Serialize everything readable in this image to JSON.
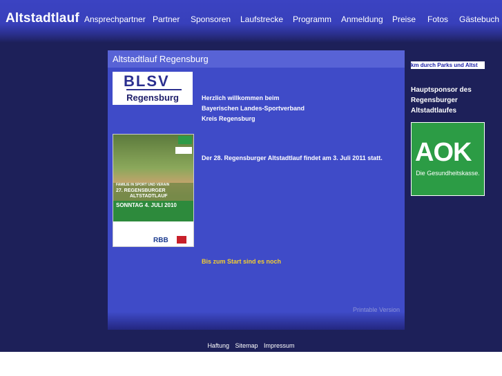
{
  "header": {
    "site_title": "Altstadtlauf",
    "nav": [
      {
        "label": "Ansprechpartner"
      },
      {
        "label": "Partner"
      },
      {
        "label": "Sponsoren"
      },
      {
        "label": "Laufstrecke"
      },
      {
        "label": "Programm"
      },
      {
        "label": "Anmeldung"
      },
      {
        "label": "Preise"
      },
      {
        "label": "Fotos"
      },
      {
        "label": "Gästebuch"
      }
    ]
  },
  "main": {
    "title": "Altstadtlauf Regensburg",
    "blsv_logo": {
      "mark": "BLSV",
      "city": "Regensburg"
    },
    "welcome": [
      "Herzlich willkommen beim",
      "Bayerischen Landes-Sportverband",
      "Kreis Regensburg"
    ],
    "poster": {
      "line1": "FAMILIE IN SPORT UND VERAIN",
      "line2": "27. REGENSBURGER",
      "line3": "ALTSTADTLAUF",
      "date": "SONNTAG  4. JULI 2010",
      "sponsor": "RBB"
    },
    "race_info": "Der 28. Regensburger Altstadtlauf findet am 3. Juli 2011 statt.",
    "countdown": "Bis zum Start sind es noch",
    "printable": "Printable Version"
  },
  "sidebar": {
    "marquee": "km durch Parks und Altst",
    "sponsor_label": [
      "Hauptsponsor des",
      "Regensburger",
      "Altstadtlaufes"
    ],
    "aok_logo": {
      "mark": "AOK",
      "tagline": "Die Gesundheitskasse."
    }
  },
  "footer": {
    "links": [
      {
        "label": "Haftung"
      },
      {
        "label": "Sitemap"
      },
      {
        "label": "Impressum"
      }
    ]
  },
  "colors": {
    "header_blue": "#3b43c2",
    "page_background": "#1d2059",
    "content_blue": "#3f4bc8",
    "countdown_yellow": "#f4cf2f",
    "aok_green": "#2c9c45"
  }
}
